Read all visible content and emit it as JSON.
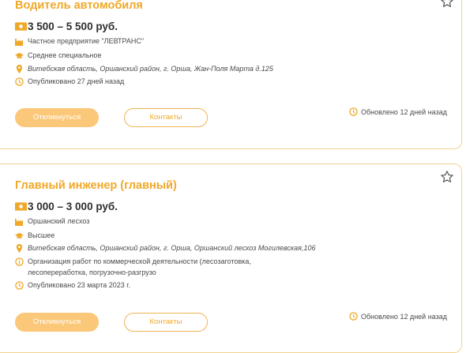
{
  "accent_color": "#f0a828",
  "vacancies": [
    {
      "title": "Водитель автомобиля",
      "salary": "3 500 – 5 500 руб.",
      "employer": "Частное предприятие \"ЛЕВТРАНС\"",
      "education": "Среднее специальное",
      "address": "Витебская область, Оршанский район, г. Орша, Жан-Поля Марта д.125",
      "published": "Опубликовано 27 дней назад",
      "apply_label": "Откликнуться",
      "contacts_label": "Контакты",
      "updated": "Обновлено 12 дней назад"
    },
    {
      "title": "Главный инженер (главный)",
      "salary": "3 000 – 3 000 руб.",
      "employer": "Оршанский лесхоз",
      "education": "Высшее",
      "address": "Витебская область, Оршанский район, г. Орша, Оршанский лесхоз Могилевская,106",
      "description": "Организация работ по коммерческой деятельности (лесозаготовка, лесопереработка, погрузочно-разгрузо",
      "published": "Опубликовано 23 марта 2023 г.",
      "apply_label": "Откликнуться",
      "contacts_label": "Контакты",
      "updated": "Обновлено 12 дней назад"
    }
  ]
}
